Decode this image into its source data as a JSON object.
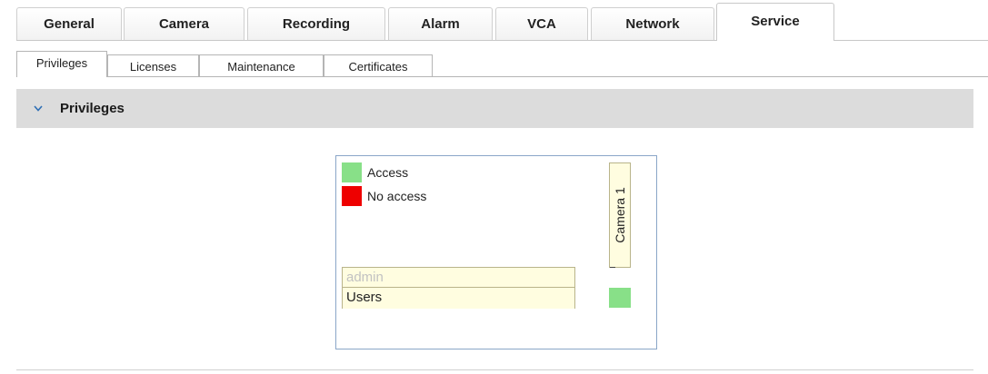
{
  "tabs": [
    {
      "label": "General"
    },
    {
      "label": "Camera"
    },
    {
      "label": "Recording"
    },
    {
      "label": "Alarm"
    },
    {
      "label": "VCA"
    },
    {
      "label": "Network"
    },
    {
      "label": "Service"
    }
  ],
  "active_tab": "Service",
  "subtabs": [
    {
      "label": "Privileges"
    },
    {
      "label": "Licenses"
    },
    {
      "label": "Maintenance"
    },
    {
      "label": "Certificates"
    }
  ],
  "active_subtab": "Privileges",
  "section": {
    "title": "Privileges",
    "icon": "chevron-down-icon"
  },
  "privileges": {
    "legend": [
      {
        "label": "Access",
        "color": "#88e088"
      },
      {
        "label": "No access",
        "color": "#ee0000"
      }
    ],
    "users": [
      "admin"
    ],
    "users_header": "Users",
    "cameras": [
      "Camera 1"
    ],
    "matrix": [
      [
        "Access"
      ]
    ]
  },
  "colors": {
    "access": "#88e088",
    "no_access": "#ee0000",
    "header_fill": "#fffde0",
    "panel_border": "#8aa6c8"
  }
}
